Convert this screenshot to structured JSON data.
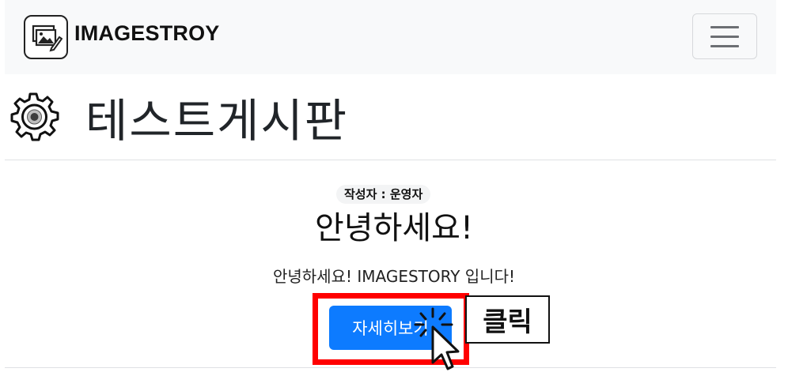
{
  "navbar": {
    "brand_name": "IMAGESTROY",
    "logo_icon": "image-edit-icon",
    "menu_icon": "hamburger-icon"
  },
  "page": {
    "icon": "gear-icon",
    "title": "테스트게시판"
  },
  "post": {
    "author": "작성자 : 운영자",
    "title": "안녕하세요!",
    "body": "안녕하세요! IMAGESTORY 입니다!",
    "detail_button_label": "자세히보기"
  },
  "annotation": {
    "click_label": "클릭",
    "highlight_color": "#ff0000",
    "cursor_icon": "mouse-pointer-icon"
  },
  "colors": {
    "primary_button": "#0d7bff",
    "navbar_bg": "#f8f9fa"
  }
}
